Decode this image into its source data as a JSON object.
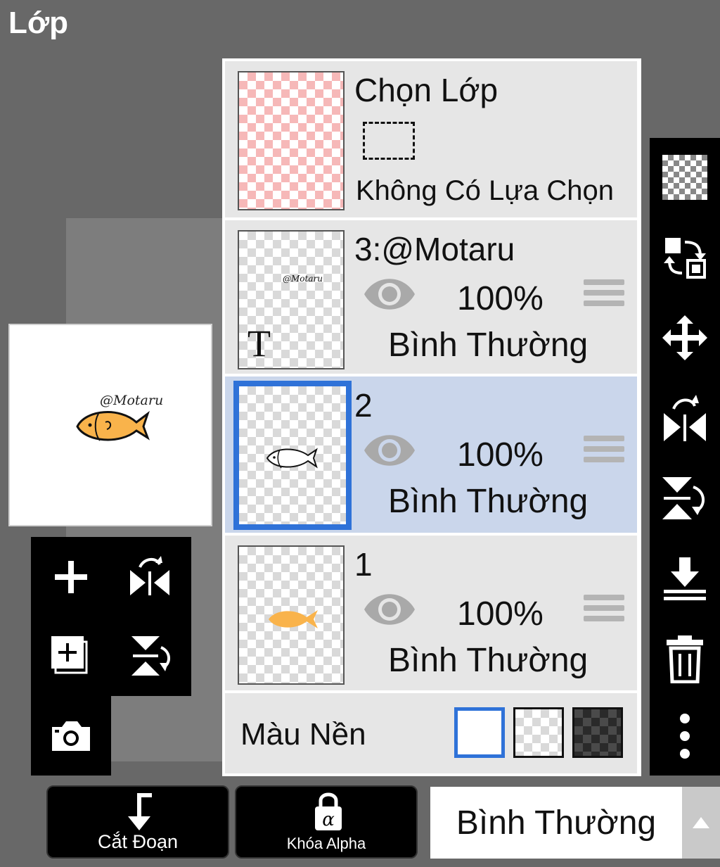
{
  "header": {
    "title": "Lớp"
  },
  "preview": {
    "watermark": "@Motaru"
  },
  "selection_layer": {
    "title": "Chọn Lớp",
    "status": "Không Có Lựa Chọn"
  },
  "layers": [
    {
      "name": "3:@Motaru",
      "opacity": "100%",
      "blend": "Bình Thường",
      "thumb_text": "@Motaru",
      "type_badge": "T",
      "selected": false
    },
    {
      "name": "2",
      "opacity": "100%",
      "blend": "Bình Thường",
      "selected": true
    },
    {
      "name": "1",
      "opacity": "100%",
      "blend": "Bình Thường",
      "selected": false
    }
  ],
  "background": {
    "label": "Màu Nền",
    "options": [
      "white",
      "transparent",
      "dark"
    ],
    "selected": "white"
  },
  "bottom": {
    "clip_label": "Cắt Đoạn",
    "alpha_lock_label": "Khóa Alpha",
    "blend_mode": "Bình Thường"
  },
  "colors": {
    "selected_blue": "#2f72d8",
    "selected_row": "#cad6eb",
    "fish_orange": "#f9b34b"
  },
  "icons": {
    "left_tools": [
      "add-layer-icon",
      "flip-horizontal-icon",
      "duplicate-layer-icon",
      "flip-vertical-icon",
      "camera-icon"
    ],
    "right_tools": [
      "transparency-icon",
      "swap-icon",
      "move-icon",
      "flip-horizontal-icon",
      "flip-vertical-icon",
      "merge-down-icon",
      "trash-icon",
      "more-icon"
    ]
  }
}
